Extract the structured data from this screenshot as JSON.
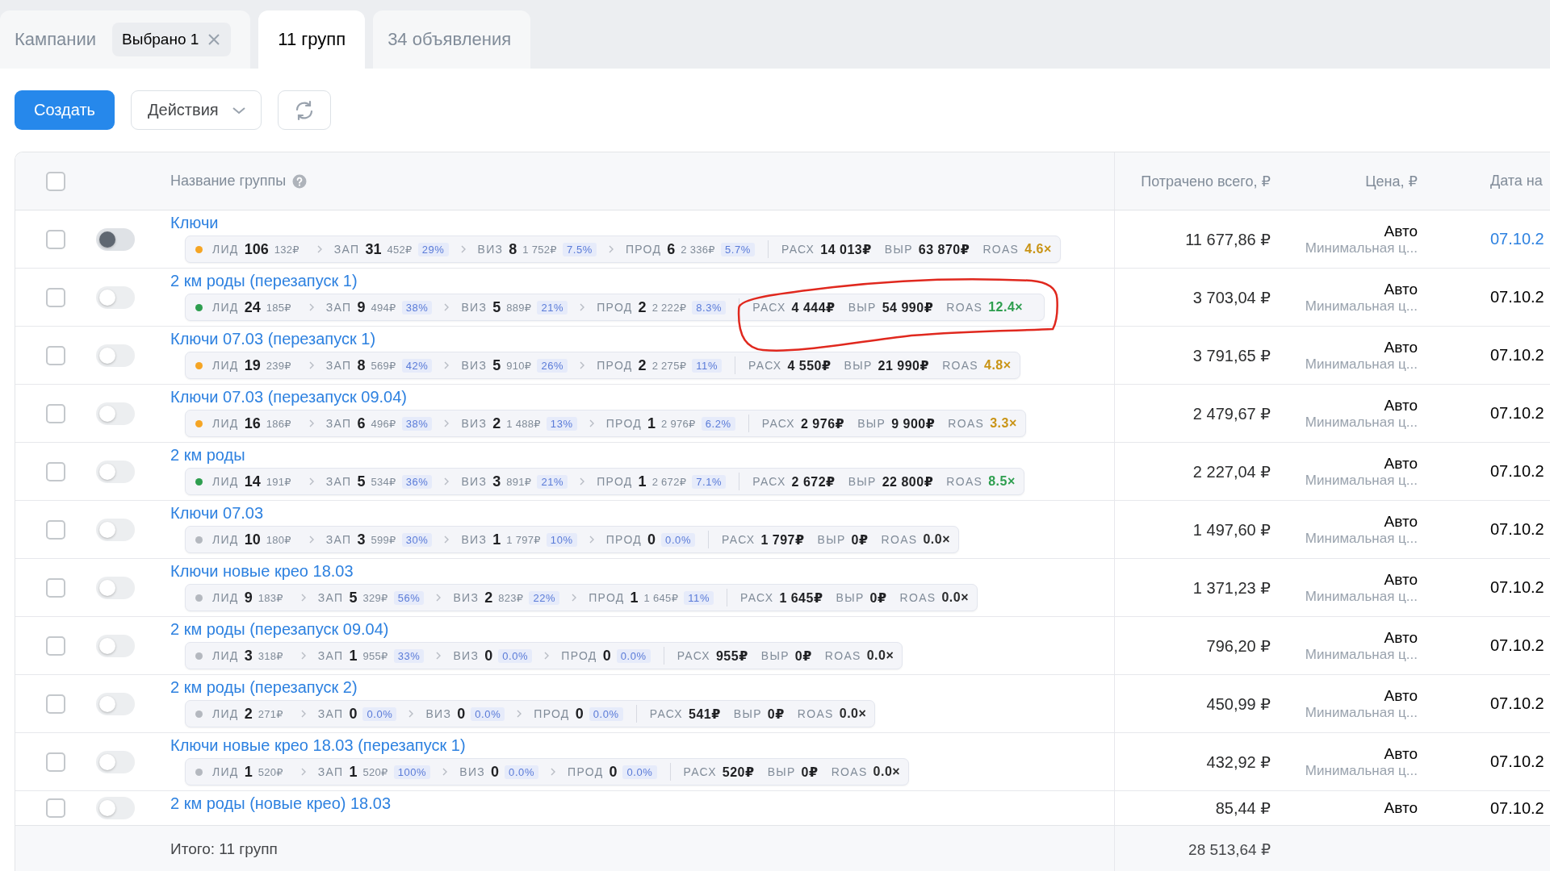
{
  "tabs": [
    {
      "label": "Кампании",
      "chip": "Выбрано 1",
      "selected": false
    },
    {
      "label": "11 групп",
      "selected": true
    },
    {
      "label": "34 объявления",
      "selected": false
    }
  ],
  "toolbar": {
    "create": "Создать",
    "actions": "Действия"
  },
  "table": {
    "all_checked": false,
    "columns": [
      "Название группы",
      "Потрачено всего, ₽",
      "Цена, ₽",
      "Дата на"
    ],
    "rows": [
      {
        "checked": false,
        "pressed": true,
        "name": "Ключи",
        "metrics": {
          "color": "#f5a524",
          "stages": [
            {
              "label": "ЛИД",
              "count": "106",
              "cost": "132₽"
            },
            {
              "label": "ЗАП",
              "count": "31",
              "cost": "452₽",
              "pct": "29%"
            },
            {
              "label": "ВИЗ",
              "count": "8",
              "cost": "1 752₽",
              "pct": "7.5%"
            },
            {
              "label": "ПРОД",
              "count": "6",
              "cost": "2 336₽",
              "pct": "5.7%"
            }
          ],
          "totals": [
            {
              "label": "РАСХ",
              "value": "14 013₽"
            },
            {
              "label": "ВЫР",
              "value": "63 870₽"
            },
            {
              "label": "ROAS",
              "value": "4.6×",
              "color": "#c99416"
            }
          ]
        },
        "spent": "11 677,86 ₽",
        "price": "Авто",
        "price_note": "Минимальная ц...",
        "date": "07.10.2",
        "date_link": true
      },
      {
        "checked": false,
        "pressed": false,
        "name": "2 км роды (перезапуск 1)",
        "metrics": {
          "circled": true,
          "color": "#2e9e4f",
          "stages": [
            {
              "label": "ЛИД",
              "count": "24",
              "cost": "185₽"
            },
            {
              "label": "ЗАП",
              "count": "9",
              "cost": "494₽",
              "pct": "38%"
            },
            {
              "label": "ВИЗ",
              "count": "5",
              "cost": "889₽",
              "pct": "21%"
            },
            {
              "label": "ПРОД",
              "count": "2",
              "cost": "2 222₽",
              "pct": "8.3%"
            }
          ],
          "totals": [
            {
              "label": "РАСХ",
              "value": "4 444₽"
            },
            {
              "label": "ВЫР",
              "value": "54 990₽"
            },
            {
              "label": "ROAS",
              "value": "12.4×",
              "color": "#2e9e4f"
            }
          ]
        },
        "spent": "3 703,04 ₽",
        "price": "Авто",
        "price_note": "Минимальная ц...",
        "date": "07.10.2",
        "date_link": false
      },
      {
        "checked": false,
        "pressed": false,
        "name": "Ключи 07.03 (перезапуск 1)",
        "metrics": {
          "color": "#f5a524",
          "stages": [
            {
              "label": "ЛИД",
              "count": "19",
              "cost": "239₽"
            },
            {
              "label": "ЗАП",
              "count": "8",
              "cost": "569₽",
              "pct": "42%"
            },
            {
              "label": "ВИЗ",
              "count": "5",
              "cost": "910₽",
              "pct": "26%"
            },
            {
              "label": "ПРОД",
              "count": "2",
              "cost": "2 275₽",
              "pct": "11%"
            }
          ],
          "totals": [
            {
              "label": "РАСХ",
              "value": "4 550₽"
            },
            {
              "label": "ВЫР",
              "value": "21 990₽"
            },
            {
              "label": "ROAS",
              "value": "4.8×",
              "color": "#c99416"
            }
          ]
        },
        "spent": "3 791,65 ₽",
        "price": "Авто",
        "price_note": "Минимальная ц...",
        "date": "07.10.2",
        "date_link": false
      },
      {
        "checked": false,
        "pressed": false,
        "name": "Ключи 07.03 (перезапуск 09.04)",
        "metrics": {
          "color": "#f5a524",
          "stages": [
            {
              "label": "ЛИД",
              "count": "16",
              "cost": "186₽"
            },
            {
              "label": "ЗАП",
              "count": "6",
              "cost": "496₽",
              "pct": "38%"
            },
            {
              "label": "ВИЗ",
              "count": "2",
              "cost": "1 488₽",
              "pct": "13%"
            },
            {
              "label": "ПРОД",
              "count": "1",
              "cost": "2 976₽",
              "pct": "6.2%"
            }
          ],
          "totals": [
            {
              "label": "РАСХ",
              "value": "2 976₽"
            },
            {
              "label": "ВЫР",
              "value": "9 900₽"
            },
            {
              "label": "ROAS",
              "value": "3.3×",
              "color": "#c99416"
            }
          ]
        },
        "spent": "2 479,67 ₽",
        "price": "Авто",
        "price_note": "Минимальная ц...",
        "date": "07.10.2",
        "date_link": false
      },
      {
        "checked": false,
        "pressed": false,
        "name": "2 км роды",
        "metrics": {
          "color": "#2e9e4f",
          "stages": [
            {
              "label": "ЛИД",
              "count": "14",
              "cost": "191₽"
            },
            {
              "label": "ЗАП",
              "count": "5",
              "cost": "534₽",
              "pct": "36%"
            },
            {
              "label": "ВИЗ",
              "count": "3",
              "cost": "891₽",
              "pct": "21%"
            },
            {
              "label": "ПРОД",
              "count": "1",
              "cost": "2 672₽",
              "pct": "7.1%"
            }
          ],
          "totals": [
            {
              "label": "РАСХ",
              "value": "2 672₽"
            },
            {
              "label": "ВЫР",
              "value": "22 800₽"
            },
            {
              "label": "ROAS",
              "value": "8.5×",
              "color": "#2e9e4f"
            }
          ]
        },
        "spent": "2 227,04 ₽",
        "price": "Авто",
        "price_note": "Минимальная ц...",
        "date": "07.10.2",
        "date_link": false
      },
      {
        "checked": false,
        "pressed": false,
        "name": "Ключи 07.03",
        "metrics": {
          "color": "#b4b8bf",
          "stages": [
            {
              "label": "ЛИД",
              "count": "10",
              "cost": "180₽"
            },
            {
              "label": "ЗАП",
              "count": "3",
              "cost": "599₽",
              "pct": "30%"
            },
            {
              "label": "ВИЗ",
              "count": "1",
              "cost": "1 797₽",
              "pct": "10%"
            },
            {
              "label": "ПРОД",
              "count": "0",
              "pct": "0.0%"
            }
          ],
          "totals": [
            {
              "label": "РАСХ",
              "value": "1 797₽"
            },
            {
              "label": "ВЫР",
              "value": "0₽"
            },
            {
              "label": "ROAS",
              "value": "0.0×",
              "color": "#2c2d2e"
            }
          ]
        },
        "spent": "1 497,60 ₽",
        "price": "Авто",
        "price_note": "Минимальная ц...",
        "date": "07.10.2",
        "date_link": false
      },
      {
        "checked": false,
        "pressed": false,
        "name": "Ключи новые крео 18.03",
        "metrics": {
          "color": "#b4b8bf",
          "stages": [
            {
              "label": "ЛИД",
              "count": "9",
              "cost": "183₽"
            },
            {
              "label": "ЗАП",
              "count": "5",
              "cost": "329₽",
              "pct": "56%"
            },
            {
              "label": "ВИЗ",
              "count": "2",
              "cost": "823₽",
              "pct": "22%"
            },
            {
              "label": "ПРОД",
              "count": "1",
              "cost": "1 645₽",
              "pct": "11%"
            }
          ],
          "totals": [
            {
              "label": "РАСХ",
              "value": "1 645₽"
            },
            {
              "label": "ВЫР",
              "value": "0₽"
            },
            {
              "label": "ROAS",
              "value": "0.0×",
              "color": "#2c2d2e"
            }
          ]
        },
        "spent": "1 371,23 ₽",
        "price": "Авто",
        "price_note": "Минимальная ц...",
        "date": "07.10.2",
        "date_link": false
      },
      {
        "checked": false,
        "pressed": false,
        "name": "2 км роды (перезапуск 09.04)",
        "metrics": {
          "color": "#b4b8bf",
          "stages": [
            {
              "label": "ЛИД",
              "count": "3",
              "cost": "318₽"
            },
            {
              "label": "ЗАП",
              "count": "1",
              "cost": "955₽",
              "pct": "33%"
            },
            {
              "label": "ВИЗ",
              "count": "0",
              "pct": "0.0%"
            },
            {
              "label": "ПРОД",
              "count": "0",
              "pct": "0.0%"
            }
          ],
          "totals": [
            {
              "label": "РАСХ",
              "value": "955₽"
            },
            {
              "label": "ВЫР",
              "value": "0₽"
            },
            {
              "label": "ROAS",
              "value": "0.0×",
              "color": "#2c2d2e"
            }
          ]
        },
        "spent": "796,20 ₽",
        "price": "Авто",
        "price_note": "Минимальная ц...",
        "date": "07.10.2",
        "date_link": false
      },
      {
        "checked": false,
        "pressed": false,
        "name": "2 км роды (перезапуск 2)",
        "metrics": {
          "color": "#b4b8bf",
          "stages": [
            {
              "label": "ЛИД",
              "count": "2",
              "cost": "271₽"
            },
            {
              "label": "ЗАП",
              "count": "0",
              "pct": "0.0%"
            },
            {
              "label": "ВИЗ",
              "count": "0",
              "pct": "0.0%"
            },
            {
              "label": "ПРОД",
              "count": "0",
              "pct": "0.0%"
            }
          ],
          "totals": [
            {
              "label": "РАСХ",
              "value": "541₽"
            },
            {
              "label": "ВЫР",
              "value": "0₽"
            },
            {
              "label": "ROAS",
              "value": "0.0×",
              "color": "#2c2d2e"
            }
          ]
        },
        "spent": "450,99 ₽",
        "price": "Авто",
        "price_note": "Минимальная ц...",
        "date": "07.10.2",
        "date_link": false
      },
      {
        "checked": false,
        "pressed": false,
        "name": "Ключи новые крео 18.03 (перезапуск 1)",
        "metrics": {
          "color": "#b4b8bf",
          "stages": [
            {
              "label": "ЛИД",
              "count": "1",
              "cost": "520₽"
            },
            {
              "label": "ЗАП",
              "count": "1",
              "cost": "520₽",
              "pct": "100%"
            },
            {
              "label": "ВИЗ",
              "count": "0",
              "pct": "0.0%"
            },
            {
              "label": "ПРОД",
              "count": "0",
              "pct": "0.0%"
            }
          ],
          "totals": [
            {
              "label": "РАСХ",
              "value": "520₽"
            },
            {
              "label": "ВЫР",
              "value": "0₽"
            },
            {
              "label": "ROAS",
              "value": "0.0×",
              "color": "#2c2d2e"
            }
          ]
        },
        "spent": "432,92 ₽",
        "price": "Авто",
        "price_note": "Минимальная ц...",
        "date": "07.10.2",
        "date_link": false
      },
      {
        "checked": false,
        "pressed": false,
        "name": "2 км роды (новые крео) 18.03",
        "spent": "85,44 ₽",
        "price": "Авто",
        "date": "07.10.2",
        "date_link": false
      }
    ],
    "footer": {
      "total_label": "Итого: 11 групп",
      "total_spent": "28 513,64 ₽"
    }
  }
}
